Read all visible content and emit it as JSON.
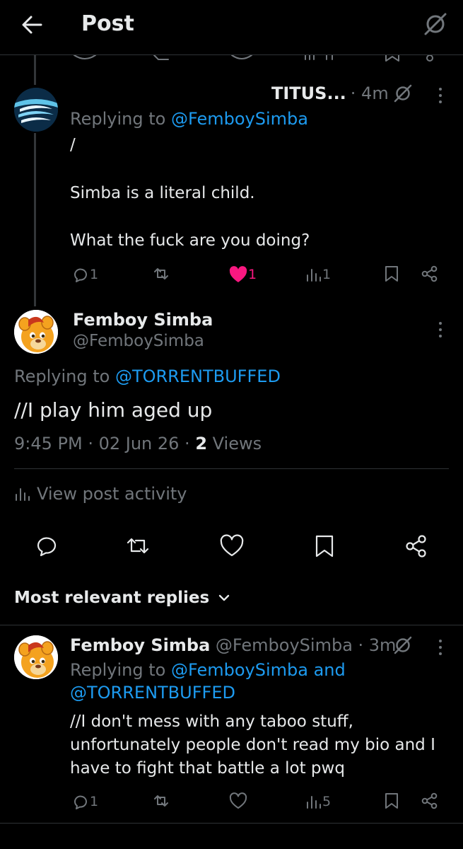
{
  "header": {
    "title": "Post",
    "back_icon": "arrow-left-icon",
    "grok_icon": "grok-icon"
  },
  "reply_1": {
    "display_name": "TITUS...",
    "time": "· 4m",
    "replying_prefix": "Replying to",
    "replying_handle": "@FemboySimba",
    "lines": [
      "/",
      "Simba is a literal child.",
      "What the fuck are you doing?"
    ],
    "reply_count": "1",
    "like_count": "1",
    "view_count": "1",
    "like_color": "#f91880"
  },
  "main_post": {
    "display_name": "Femboy Simba",
    "handle": "@FemboySimba",
    "replying_prefix": "Replying to",
    "replying_handle": "@TORRENTBUFFED",
    "text": "//I play him aged up",
    "time": "9:45 PM · 02 Jun 26 · ",
    "views_number": "2",
    "views_label": " Views",
    "activity_label": "View post activity"
  },
  "sort": {
    "label": "Most relevant replies"
  },
  "reply_2": {
    "display_name": "Femboy Simba",
    "handle_time": "@FemboySimba · 3m",
    "replying_prefix": "Replying to",
    "replying_handles_line1": "@FemboySimba and",
    "replying_handles_line2": "@TORRENTBUFFED",
    "lines": [
      "//I don't mess with any taboo stuff,",
      "unfortunately people don't read my bio and I",
      "have to fight that battle a lot pwq"
    ],
    "reply_count": "1",
    "view_count": "5"
  },
  "colors": {
    "link": "#1d9bf0",
    "muted": "#71767b",
    "like": "#f91880",
    "background": "#000000"
  }
}
